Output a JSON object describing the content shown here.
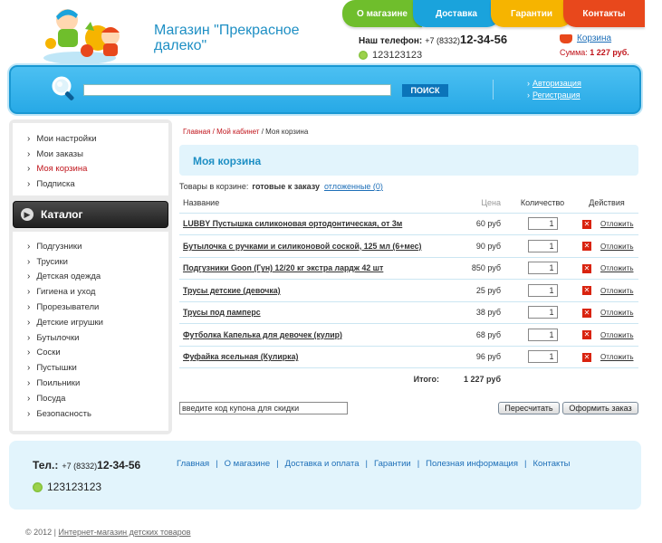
{
  "header": {
    "shop_name": "Магазин \"Прекрасное далеко\"",
    "phone_label": "Наш телефон:",
    "phone_code": "+7 (8332)",
    "phone_number": "12-34-56",
    "icq_number": "123123123",
    "cart_link": "Корзина",
    "cart_sum_label": "Сумма:",
    "cart_sum_value": "1 227 руб."
  },
  "top_nav": [
    {
      "label": "О магазине"
    },
    {
      "label": "Доставка"
    },
    {
      "label": "Гарантии"
    },
    {
      "label": "Контакты"
    }
  ],
  "search": {
    "button_label": "ПОИСК",
    "value": ""
  },
  "auth": {
    "login": "Авторизация",
    "register": "Регистрация"
  },
  "account_menu": [
    {
      "label": "Мои настройки"
    },
    {
      "label": "Мои заказы"
    },
    {
      "label": "Моя корзина"
    },
    {
      "label": "Подписка"
    }
  ],
  "catalog": {
    "title": "Каталог",
    "items": [
      {
        "label": "Подгузники"
      },
      {
        "label": "Трусики"
      },
      {
        "label": "Детская одежда"
      },
      {
        "label": "Гигиена и уход"
      },
      {
        "label": "Прорезыватели"
      },
      {
        "label": "Детские игрушки"
      },
      {
        "label": "Бутылочки"
      },
      {
        "label": "Соски"
      },
      {
        "label": "Пустышки"
      },
      {
        "label": "Поильники"
      },
      {
        "label": "Посуда"
      },
      {
        "label": "Безопасность"
      }
    ]
  },
  "breadcrumb": {
    "home": "Главная",
    "sep1": " / ",
    "cabinet": "Мой кабинет",
    "sep2": " / ",
    "current": "Моя корзина"
  },
  "page_title": "Моя корзина",
  "cart_status": {
    "label": "Товары в корзине:",
    "ready": "готовые к заказу",
    "deferred": "отложенные (0)"
  },
  "table": {
    "headers": {
      "name": "Название",
      "price": "Цена",
      "qty": "Количество",
      "actions": "Действия"
    },
    "rows": [
      {
        "name": "LUBBY Пустышка силиконовая ортодонтическая, от 3м",
        "price": "60 руб",
        "qty": "1",
        "defer": "Отложить"
      },
      {
        "name": "Бутылочка с ручками и силиконовой соской, 125 мл (6+мес)",
        "price": "90 руб",
        "qty": "1",
        "defer": "Отложить"
      },
      {
        "name": "Подгузники Goon (Гун) 12/20 кг экстра лардж 42 шт",
        "price": "850 руб",
        "qty": "1",
        "defer": "Отложить"
      },
      {
        "name": "Трусы детские (девочка)",
        "price": "25 руб",
        "qty": "1",
        "defer": "Отложить"
      },
      {
        "name": "Трусы под памперс",
        "price": "38 руб",
        "qty": "1",
        "defer": "Отложить"
      },
      {
        "name": "Футболка Капелька для девочек (кулир)",
        "price": "68 руб",
        "qty": "1",
        "defer": "Отложить"
      },
      {
        "name": "Фуфайка ясельная (Кулирка)",
        "price": "96 руб",
        "qty": "1",
        "defer": "Отложить"
      }
    ],
    "total_label": "Итого:",
    "total_value": "1 227 руб"
  },
  "coupon": {
    "value": "введите код купона для скидки"
  },
  "buttons": {
    "recalc": "Пересчитать",
    "order": "Оформить заказ"
  },
  "footer": {
    "tel_label": "Тел.:",
    "phone_code": "+7 (8332)",
    "phone_number": "12-34-56",
    "icq_number": "123123123",
    "nav": [
      {
        "label": "Главная"
      },
      {
        "label": "О магазине"
      },
      {
        "label": "Доставка и оплата"
      },
      {
        "label": "Гарантии"
      },
      {
        "label": "Полезная информация"
      },
      {
        "label": "Контакты"
      }
    ],
    "copyright_prefix": "© 2012 |",
    "copyright_link": "Интернет-магазин детских товаров"
  },
  "colors": {
    "accent_blue": "#27a9e6",
    "link_red": "#c0141b",
    "tab_green": "#6fbe2c",
    "tab_blue": "#1aa3dc",
    "tab_yellow": "#f6b400",
    "tab_red": "#e8481c"
  }
}
